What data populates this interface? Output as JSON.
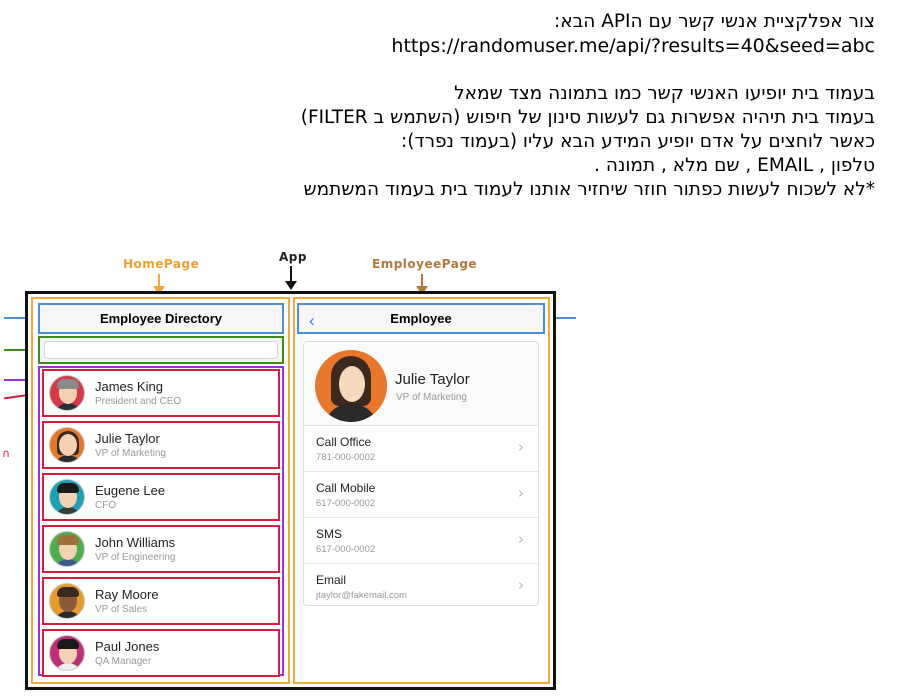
{
  "instructions": {
    "line1": "צור אפלקציית אנשי קשר עם הAPI הבא:",
    "url": "https://randomuser.me/api/?results=40&seed=abc",
    "line2": "בעמוד בית יופיעו האנשי קשר כמו בתמונה מצד שמאל",
    "line3": "בעמוד בית תיהיה אפשרות גם לעשות סינון של חיפוש (השתמש  ב FILTER)",
    "line4": "כאשר לוחצים על אדם יופיע המידע הבא עליו (בעמוד נפרד):",
    "line5": "טלפון , EMAIL , שם מלא , תמונה .",
    "line6": "*לא לשכוח לעשות כפתור חוזר שיחזיר אותנו לעמוד בית בעמוד המשתמש"
  },
  "diagram_labels": {
    "home": "HomePage",
    "app": "App",
    "employee": "EmployeePage"
  },
  "home": {
    "title": "Employee Directory",
    "employees": [
      {
        "name": "James King",
        "title": "President and CEO"
      },
      {
        "name": "Julie Taylor",
        "title": "VP of Marketing"
      },
      {
        "name": "Eugene Lee",
        "title": "CFO"
      },
      {
        "name": "John Williams",
        "title": "VP of Engineering"
      },
      {
        "name": "Ray Moore",
        "title": "VP of Sales"
      },
      {
        "name": "Paul Jones",
        "title": "QA Manager"
      }
    ]
  },
  "employee_page": {
    "header": "Employee",
    "name": "Julie Taylor",
    "title": "VP of Marketing",
    "actions": [
      {
        "label": "Call Office",
        "value": "781-000-0002"
      },
      {
        "label": "Call Mobile",
        "value": "617-000-0002"
      },
      {
        "label": "SMS",
        "value": "617-000-0002"
      },
      {
        "label": "Email",
        "value": "jtaylor@fakemail.com"
      }
    ]
  },
  "colors": {
    "app_frame": "#111111",
    "page_frame": "#f2a93b",
    "header_frame": "#4a90d9",
    "search_frame": "#3c8c1e",
    "list_frame": "#a030d8",
    "row_frame": "#d0203a",
    "back_accent": "#2b7fe0"
  },
  "icons": {
    "back": "chevron-left-icon",
    "row_action": "chevron-right-icon"
  }
}
